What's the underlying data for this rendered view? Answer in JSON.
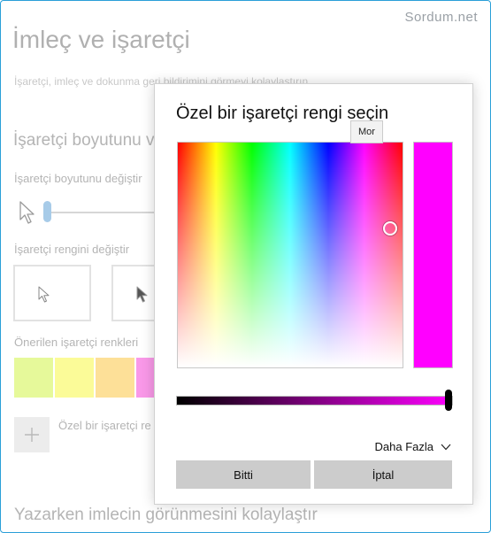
{
  "watermark": "Sordum.net",
  "page": {
    "title": "İmleç ve işaretçi",
    "description": "İşaretçi, imleç ve dokunma geri bildirimini görmeyi kolaylaştırın",
    "pointer_size_section": "İşaretçi boyutunu v",
    "pointer_size_label": "İşaretçi boyutunu değiştir",
    "pointer_size_value": 0.0,
    "pointer_color_label": "İşaretçi rengini değiştir",
    "suggested_colors_label": "Önerilen işaretçi renkleri",
    "custom_color_label": "Özel bir işaretçi re",
    "bottom_section_title": "Yazarken imlecin görünmesini kolaylaştır",
    "suggested_colors": [
      "#e6f99a",
      "#fbfb98",
      "#fde098",
      "#f998e8"
    ],
    "icons": {
      "pointer": "arrow-cursor-icon",
      "add": "plus-icon"
    }
  },
  "dialog": {
    "title": "Özel bir işaretçi rengi seçin",
    "tooltip": "Mor",
    "selected_color": "#ff00ff",
    "value_slider_level": 1.0,
    "more_label": "Daha Fazla",
    "more_icon": "chevron-down-icon",
    "done_label": "Bitti",
    "cancel_label": "İptal"
  },
  "colors": {
    "accent": "#2a9fd8",
    "button_bg": "#cccccc"
  }
}
